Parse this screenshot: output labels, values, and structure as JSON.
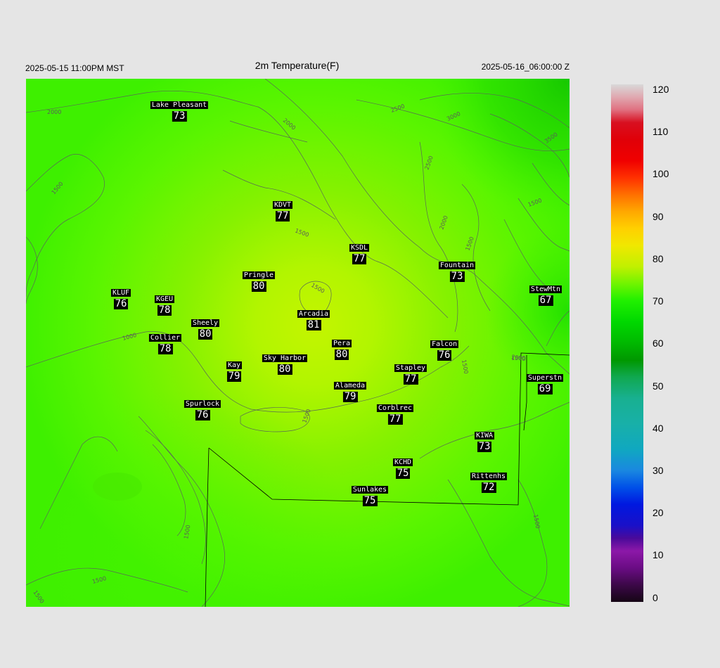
{
  "header": {
    "local_time": "2025-05-15 11:00PM MST",
    "title": "2m Temperature(F)",
    "valid_time": "2025-05-16_06:00:00 Z"
  },
  "map": {
    "contour_labels": [
      "2000",
      "2000",
      "2500",
      "3000",
      "3500",
      "2500",
      "1500",
      "1500",
      "1500",
      "1500",
      "2000",
      "1500",
      "1500",
      "1500",
      "1500",
      "2000",
      "1000",
      "1500",
      "1500",
      "1500",
      "1500"
    ],
    "stations": [
      {
        "name": "Lake Pleasant",
        "value": "73"
      },
      {
        "name": "KDVT",
        "value": "77"
      },
      {
        "name": "KSDL",
        "value": "77"
      },
      {
        "name": "Fountain",
        "value": "73"
      },
      {
        "name": "Pringle",
        "value": "80"
      },
      {
        "name": "KLUF",
        "value": "76"
      },
      {
        "name": "KGEU",
        "value": "78"
      },
      {
        "name": "StewMtn",
        "value": "67"
      },
      {
        "name": "Arcadia",
        "value": "81"
      },
      {
        "name": "Sheely",
        "value": "80"
      },
      {
        "name": "Collier",
        "value": "78"
      },
      {
        "name": "Pera",
        "value": "80"
      },
      {
        "name": "Falcon",
        "value": "76"
      },
      {
        "name": "Sky Harbor",
        "value": "80"
      },
      {
        "name": "Kay",
        "value": "79"
      },
      {
        "name": "Stapley",
        "value": "77"
      },
      {
        "name": "Superstn",
        "value": "69"
      },
      {
        "name": "Alameda",
        "value": "79"
      },
      {
        "name": "Spurlock",
        "value": "76"
      },
      {
        "name": "Corblrec",
        "value": "77"
      },
      {
        "name": "KIWA",
        "value": "73"
      },
      {
        "name": "KCHD",
        "value": "75"
      },
      {
        "name": "Rittenhs",
        "value": "72"
      },
      {
        "name": "Sunlakes",
        "value": "75"
      }
    ]
  },
  "colorbar": {
    "ticks": [
      "120",
      "110",
      "100",
      "90",
      "80",
      "70",
      "60",
      "50",
      "40",
      "30",
      "20",
      "10",
      "0"
    ],
    "range": [
      0,
      122
    ]
  }
}
